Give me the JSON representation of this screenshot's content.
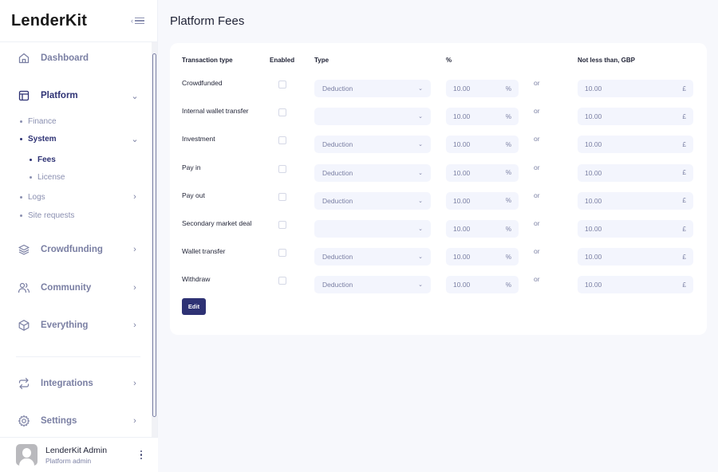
{
  "sidebar": {
    "logo": "LenderKit",
    "nav": {
      "dashboard": "Dashboard",
      "platform": "Platform",
      "finance": "Finance",
      "system": "System",
      "fees": "Fees",
      "license": "License",
      "logs": "Logs",
      "site_requests": "Site requests",
      "crowdfunding": "Crowdfunding",
      "community": "Community",
      "everything": "Everything",
      "integrations": "Integrations",
      "settings": "Settings"
    },
    "user": {
      "name": "LenderKit Admin",
      "role": "Platform admin"
    }
  },
  "page": {
    "title": "Platform Fees"
  },
  "table": {
    "headers": {
      "transaction_type": "Transaction type",
      "enabled": "Enabled",
      "type": "Type",
      "percent": "%",
      "min": "Not less than, GBP"
    },
    "or_label": "or",
    "pct_suffix": "%",
    "gbp_suffix": "£",
    "rows": [
      {
        "label": "Crowdfunded",
        "enabled": false,
        "type": "Deduction",
        "percent": "10.00",
        "min": "10.00"
      },
      {
        "label": "Internal wallet transfer",
        "enabled": false,
        "type": "",
        "percent": "10.00",
        "min": "10.00"
      },
      {
        "label": "Investment",
        "enabled": false,
        "type": "Deduction",
        "percent": "10.00",
        "min": "10.00"
      },
      {
        "label": "Pay in",
        "enabled": false,
        "type": "Deduction",
        "percent": "10.00",
        "min": "10.00"
      },
      {
        "label": "Pay out",
        "enabled": false,
        "type": "Deduction",
        "percent": "10.00",
        "min": "10.00"
      },
      {
        "label": "Secondary market deal",
        "enabled": false,
        "type": "",
        "percent": "10.00",
        "min": "10.00"
      },
      {
        "label": "Wallet transfer",
        "enabled": false,
        "type": "Deduction",
        "percent": "10.00",
        "min": "10.00"
      },
      {
        "label": "Withdraw",
        "enabled": false,
        "type": "Deduction",
        "percent": "10.00",
        "min": "10.00"
      }
    ],
    "edit_label": "Edit"
  },
  "colors": {
    "brand": "#2e3274",
    "muted": "#7a7fa3",
    "field_bg": "#f3f5fd",
    "page_bg": "#f7f8fc"
  }
}
